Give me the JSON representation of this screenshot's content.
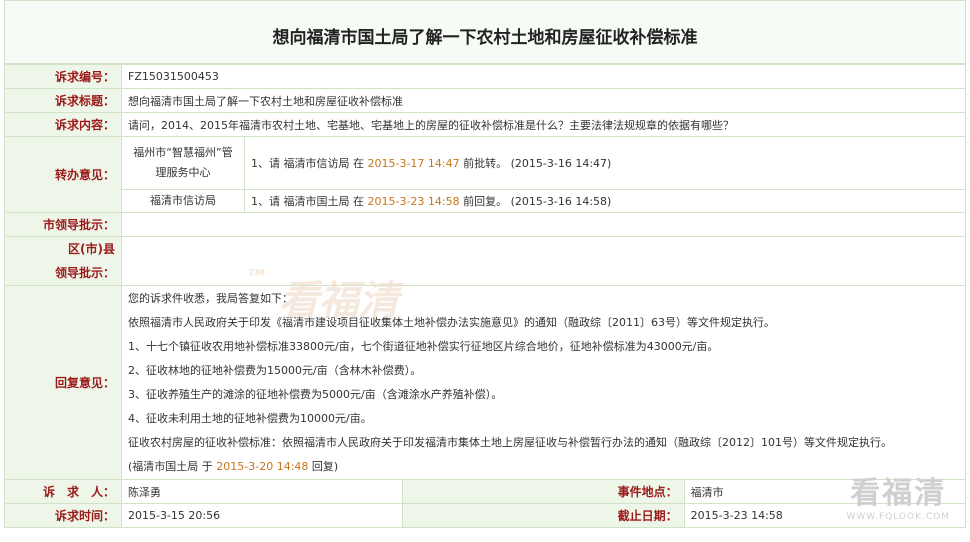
{
  "page": {
    "title": "想向福清市国土局了解一下农村土地和房屋征收补偿标准"
  },
  "labels": {
    "number": "诉求编号：",
    "subject": "诉求标题：",
    "content": "诉求内容：",
    "transfer": "转办意见：",
    "city_leader": "市领导批示：",
    "district_line1": "区(市)县",
    "district_line2": "领导批示：",
    "reply": "回复意见：",
    "person": "诉　求　人：",
    "location": "事件地点：",
    "time": "诉求时间：",
    "deadline": "截止日期："
  },
  "petition": {
    "number": "FZ15031500453",
    "subject": "想向福清市国土局了解一下农村土地和房屋征收补偿标准",
    "content": "请问，2014、2015年福清市农村土地、宅基地、宅基地上的房屋的征收补偿标准是什么？主要法律法规规章的依据有哪些？",
    "person": "陈泽勇",
    "location": "福清市",
    "time": "2015-3-15 20:56",
    "deadline": "2015-3-23 14:58"
  },
  "transfers": [
    {
      "dept": "福州市“智慧福州”管理服务中心",
      "pre": "1、请 福清市信访局 在",
      "date": "2015-3-17 14:47",
      "post": "前批转。 (2015-3-16 14:47)"
    },
    {
      "dept": "福清市信访局",
      "pre": "1、请 福清市国土局 在",
      "date": "2015-3-23 14:58",
      "post": "前回复。 (2015-3-16 14:58)"
    }
  ],
  "reply": {
    "lines": [
      "您的诉求件收悉，我局答复如下：",
      "依照福清市人民政府关于印发《福清市建设项目征收集体土地补偿办法实施意见》的通知（融政综〔2011〕63号）等文件规定执行。",
      "1、十七个镇征收农用地补偿标准33800元/亩，七个街道征地补偿实行征地区片综合地价，征地补偿标准为43000元/亩。",
      "2、征收林地的征地补偿费为15000元/亩（含林木补偿费）。",
      "3、征收养殖生产的滩涂的征地补偿费为5000元/亩（含滩涂水产养殖补偿）。",
      "4、征收未利用土地的征地补偿费为10000元/亩。",
      "征收农村房屋的征收补偿标准：依照福清市人民政府关于印发福清市集体土地上房屋征收与补偿暂行办法的通知（融政综〔2012〕101号）等文件规定执行。"
    ],
    "sign_pre": "(福清市国土局 于",
    "sign_date": "2015-3-20 14:48",
    "sign_post": "回复)"
  },
  "watermark": {
    "center_text": "看福清",
    "center_tm": "TM",
    "corner_text": "看福清",
    "corner_url": "WWW.FQLOOK.COM"
  },
  "colors": {
    "label_text": "#9b1b1b",
    "label_bg": "#eef6e9",
    "border": "#cfe3c7",
    "highlight": "#c8751a"
  }
}
